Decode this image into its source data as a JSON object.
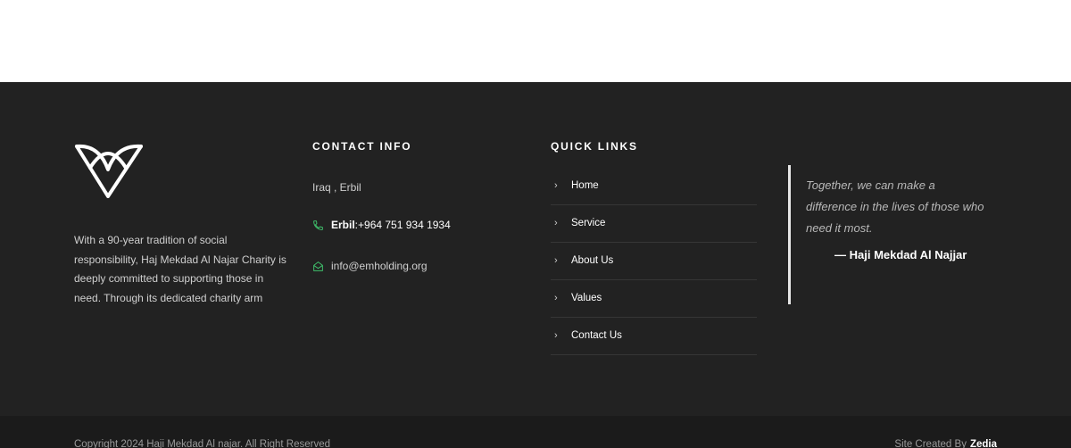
{
  "colors": {
    "footer_bg": "#222222",
    "bottom_bg": "#1b1b1b",
    "accent_green": "#3fbf6b",
    "text_light": "#cfcfcf",
    "text_white": "#ffffff"
  },
  "about": {
    "text": "With a 90-year tradition of social responsibility, Haj Mekdad Al Najar Charity is deeply committed to supporting those in need. Through its dedicated charity arm"
  },
  "contact": {
    "heading": "CONTACT INFO",
    "address": "Iraq , Erbil",
    "phone_city": "Erbil",
    "phone_number": ":+964 751 934 1934",
    "email": "info@emholding.org",
    "phone_icon": "phone-icon",
    "email_icon": "envelope-open-icon"
  },
  "quick_links": {
    "heading": "QUICK LINKS",
    "items": [
      {
        "label": "Home"
      },
      {
        "label": "Service"
      },
      {
        "label": "About Us"
      },
      {
        "label": "Values"
      },
      {
        "label": "Contact Us"
      }
    ]
  },
  "quote": {
    "text": "Together, we can make a difference in the lives of those who need it most.",
    "author": "— Haji Mekdad Al Najjar"
  },
  "bottom": {
    "copyright": "Copyright 2024 Haji Mekdad Al najar. All Right Reserved",
    "credit_prefix": "Site Created By",
    "credit_brand": "Zedia"
  }
}
